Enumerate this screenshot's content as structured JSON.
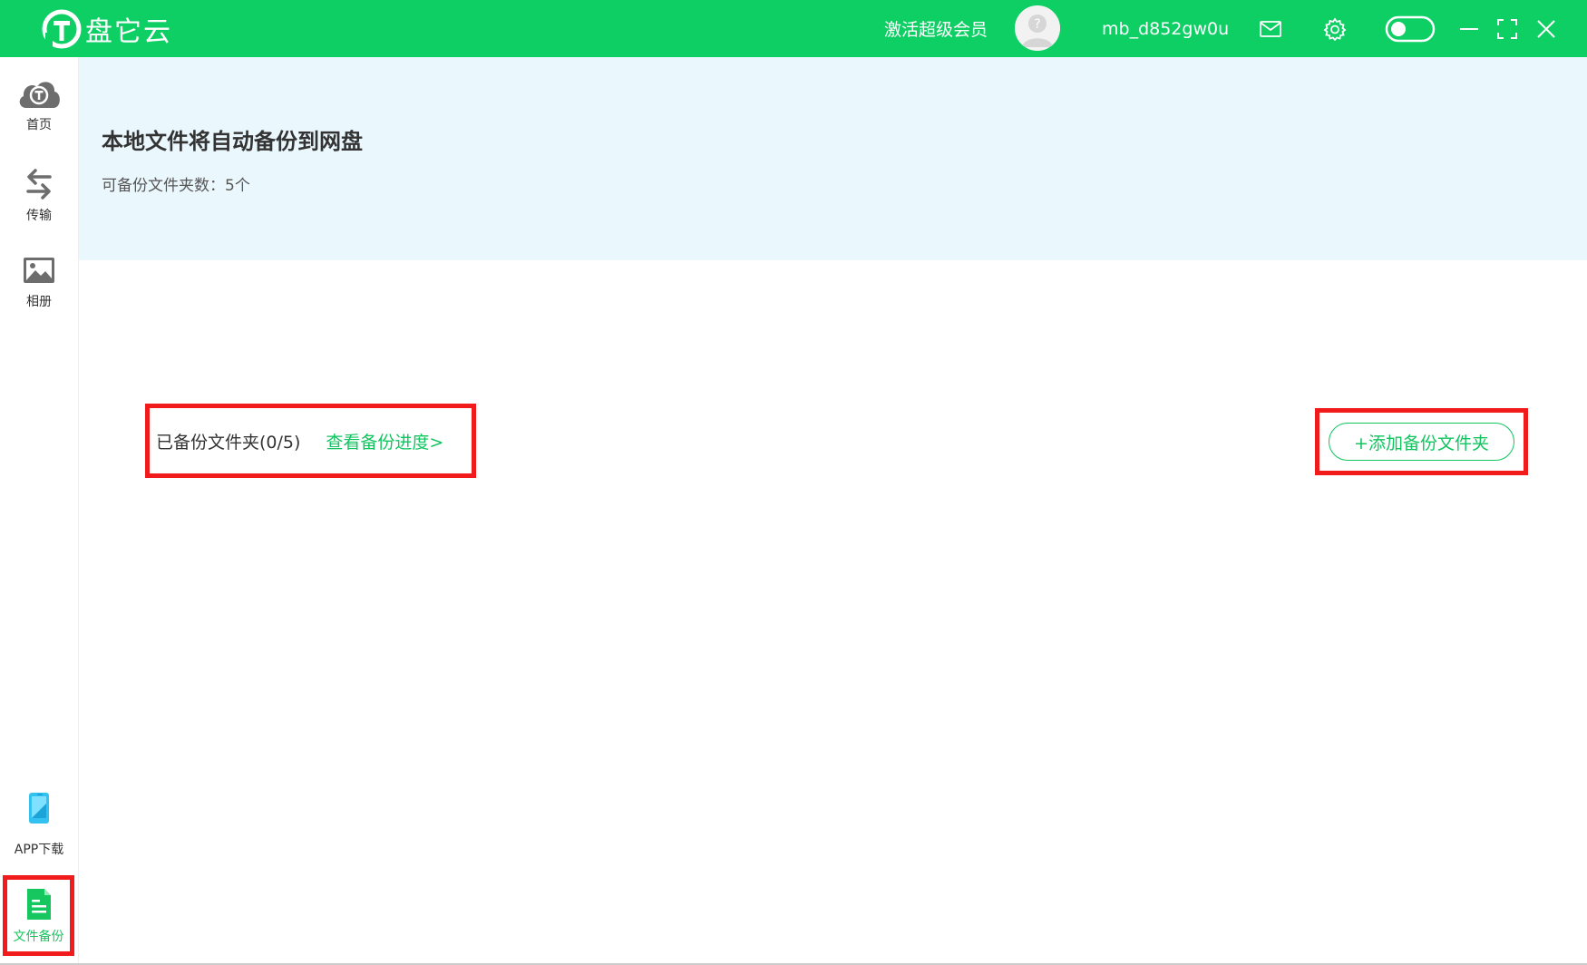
{
  "app": {
    "name": "盘它云",
    "brand_color": "#0ecf64",
    "accent_color": "#11c45f"
  },
  "header": {
    "vip_label": "激活超级会员",
    "username": "mb_d852gw0u",
    "icons": [
      "mail-icon",
      "gear-icon",
      "toggle-switch",
      "minimize-icon",
      "fullscreen-icon",
      "close-icon"
    ]
  },
  "sidebar": {
    "items": [
      {
        "label": "首页",
        "icon": "cloud-home-icon"
      },
      {
        "label": "传输",
        "icon": "transfer-arrows-icon"
      },
      {
        "label": "相册",
        "icon": "image-icon"
      },
      {
        "label": "APP下载",
        "icon": "phone-icon"
      },
      {
        "label": "文件备份",
        "icon": "document-icon",
        "active": true
      }
    ]
  },
  "banner": {
    "title": "本地文件将自动备份到网盘",
    "subtitle": "可备份文件夹数：5个"
  },
  "backup": {
    "backed_up_label": "已备份文件夹(0/5)",
    "progress_link": "查看备份进度>",
    "add_button": "+添加备份文件夹"
  }
}
